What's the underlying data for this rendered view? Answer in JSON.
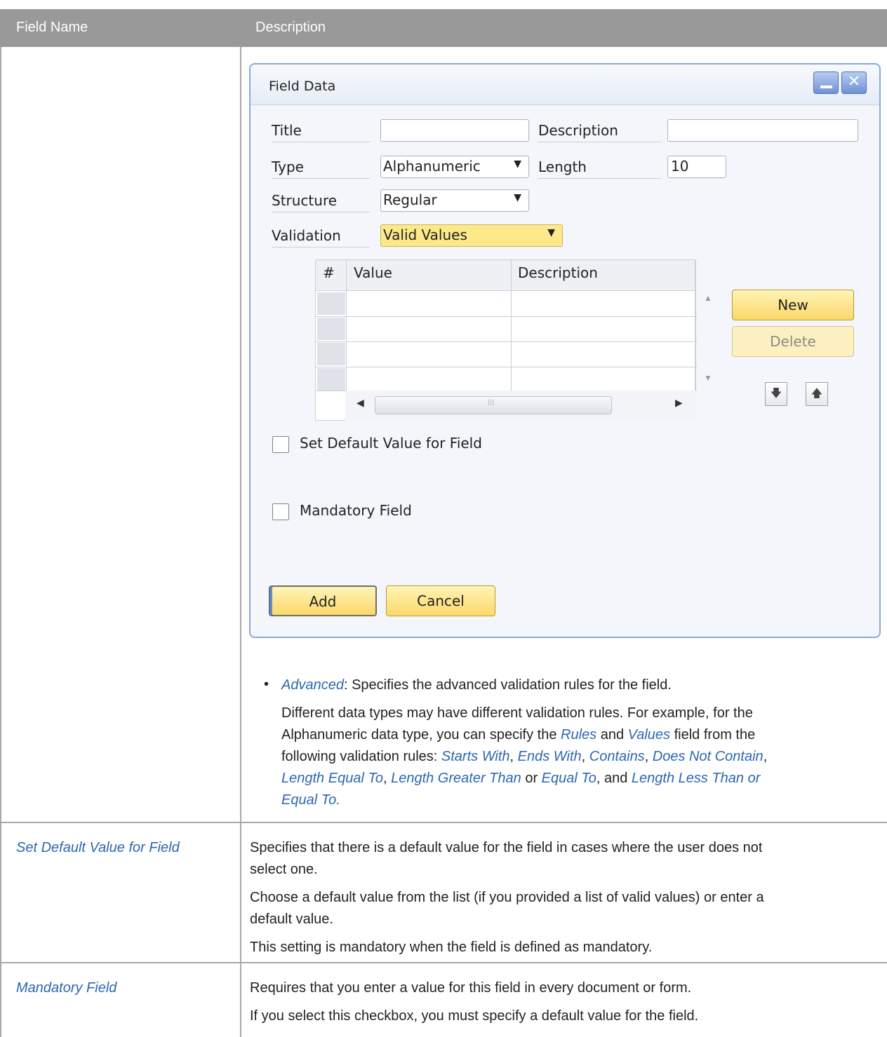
{
  "table": {
    "headers": {
      "field_name": "Field Name",
      "description": "Description"
    }
  },
  "dialog": {
    "title": "Field Data",
    "labels": {
      "title": "Title",
      "description": "Description",
      "type": "Type",
      "length": "Length",
      "structure": "Structure",
      "validation": "Validation"
    },
    "values": {
      "title": "",
      "description": "",
      "type": "Alphanumeric",
      "length": "10",
      "structure": "Regular",
      "validation": "Valid Values"
    },
    "grid": {
      "headers": [
        "#",
        "Value",
        "Description"
      ],
      "rows": 4
    },
    "buttons": {
      "new": "New",
      "delete": "Delete",
      "add": "Add",
      "cancel": "Cancel"
    },
    "checkboxes": {
      "default_value": "Set Default Value for Field",
      "mandatory": "Mandatory Field"
    }
  },
  "advanced": {
    "term": "Advanced",
    "text": ": Specifies the advanced validation rules for the field.",
    "p_line1": "Different data types may have different validation rules. For example, for the",
    "p_line2_a": "Alphanumeric data type, you can specify the ",
    "rules": "Rules",
    "and": " and ",
    "values_term": "Values",
    "p_line2_b": " field from the",
    "p_line3_a": "following validation rules: ",
    "starts_with": "Starts With",
    "comma": ", ",
    "ends_with": "Ends With",
    "contains": "Contains",
    "does_not_contain": "Does Not Contain",
    "length_equal": "Length Equal To",
    "length_greater": "Length Greater Than",
    "or": " or ",
    "equal_to": "Equal To",
    "and_sep": ", and ",
    "length_less_a": "Length Less Than or",
    "length_less_b": "Equal To",
    "period": "."
  },
  "rows": [
    {
      "name": "Set Default Value for Field",
      "lines": [
        "Specifies that there is a default value for the field in cases where the user does not",
        "select one.",
        "Choose a default value from the list (if you provided a list of valid values) or enter a",
        "default value.",
        "This setting is mandatory when the field is defined as mandatory."
      ]
    },
    {
      "name": "Mandatory Field",
      "lines": [
        "Requires that you enter a value for this field in every document or form.",
        "If you select this checkbox, you must specify a default value for the field."
      ]
    }
  ]
}
